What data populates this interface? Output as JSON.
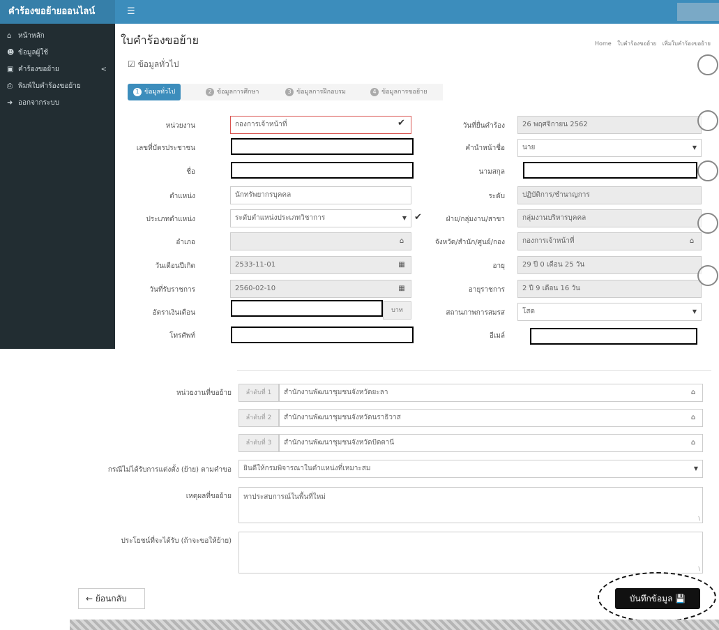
{
  "app": {
    "title": "คำร้องขอย้ายออนไลน์",
    "menu_icon": "hamburger-icon"
  },
  "sidebar": {
    "items": [
      {
        "label": "หน้าหลัก",
        "icon": "home-icon"
      },
      {
        "label": "ข้อมูลผู้ใช้",
        "icon": "users-icon"
      },
      {
        "label": "คำร้องขอย้าย",
        "icon": "monitor-icon",
        "chevron": "<"
      },
      {
        "label": "พิมพ์ใบคำร้องขอย้าย",
        "icon": "print-icon"
      },
      {
        "label": "ออกจากระบบ",
        "icon": "sign-out-icon"
      }
    ]
  },
  "header": {
    "title": "ใบคำร้องขอย้าย",
    "breadcrumb": [
      "Home",
      "ใบคำร้องขอย้าย",
      "เพิ่มใบคำร้องขอย้าย"
    ]
  },
  "section": {
    "title": "ข้อมูลทั่วไป"
  },
  "steps": [
    {
      "num": "1",
      "label": "ข้อมูลทั่วไป",
      "active": true
    },
    {
      "num": "2",
      "label": "ข้อมูลการศึกษา",
      "active": false
    },
    {
      "num": "3",
      "label": "ข้อมูลการฝึกอบรม",
      "active": false
    },
    {
      "num": "4",
      "label": "ข้อมูลการขอย้าย",
      "active": false
    }
  ],
  "form": {
    "agency_label": "หน่วยงาน",
    "agency_value": "กองการเจ้าหน้าที่",
    "submit_date_label": "วันที่ยื่นคำร้อง",
    "submit_date_value": "26 พฤศจิกายน 2562",
    "id_card_label": "เลขที่บัตรประชาชน",
    "prefix_label": "คำนำหน้าชื่อ",
    "prefix_value": "นาย",
    "name_label": "ชื่อ",
    "surname_label": "นามสกุล",
    "position_label": "ตำแหน่ง",
    "position_value": "นักทรัพยากรบุคคล",
    "level_label": "ระดับ",
    "level_value": "ปฏิบัติการ/ชำนาญการ",
    "position_type_label": "ประเภทตำแหน่ง",
    "position_type_value": "ระดับตำแหน่งประเภทวิชาการ",
    "division_label": "ฝ่าย/กลุ่มงาน/สาขา",
    "division_value": "กลุ่มงานบริหารบุคคล",
    "district_label": "อำเภอ",
    "province_label": "จังหวัด/สำนัก/ศูนย์/กอง",
    "province_value": "กองการเจ้าหน้าที่",
    "start_date_label": "วันเดือนปีเกิด",
    "start_date_value": "2533-11-01",
    "age_label": "อายุ",
    "age_value": "29 ปี 0 เดือน 25 วัน",
    "gov_date_label": "วันที่รับราชการ",
    "gov_date_value": "2560-02-10",
    "service_label": "อายุราชการ",
    "service_value": "2 ปี 9 เดือน 16 วัน",
    "salary_label": "อัตราเงินเดือน",
    "salary_unit": "บาท",
    "marital_label": "สถานภาพการสมรส",
    "marital_value": "โสด",
    "phone_label": "โทรศัพท์",
    "email_label": "อีเมล์"
  },
  "transfer": {
    "dest_label": "หน่วยงานที่ขอย้าย",
    "priorities": [
      {
        "order": "ลำดับที่ 1",
        "value": "สำนักงานพัฒนาชุมชนจังหวัดยะลา"
      },
      {
        "order": "ลำดับที่ 2",
        "value": "สำนักงานพัฒนาชุมชนจังหวัดนราธิวาส"
      },
      {
        "order": "ลำดับที่ 3",
        "value": "สำนักงานพัฒนาชุมชนจังหวัดปัตตานี"
      }
    ],
    "fallback_label": "กรณีไม่ได้รับการแต่งตั้ง (ย้าย) ตามคำขอ",
    "fallback_value": "ยินดีให้กรมพิจารณาในตำแหน่งที่เหมาะสม",
    "reason_label": "เหตุผลที่ขอย้าย",
    "reason_value": "หาประสบการณ์ในพื้นที่ใหม่",
    "benefit_label": "ประโยชน์ที่จะได้รับ (ถ้าจะขอให้ย้าย)",
    "benefit_value": ""
  },
  "buttons": {
    "back_label": "ย้อนกลับ",
    "save_label": "บันทึกข้อมูล"
  },
  "colors": {
    "brand": "#3c8dbc",
    "sidebar": "#222d32"
  }
}
